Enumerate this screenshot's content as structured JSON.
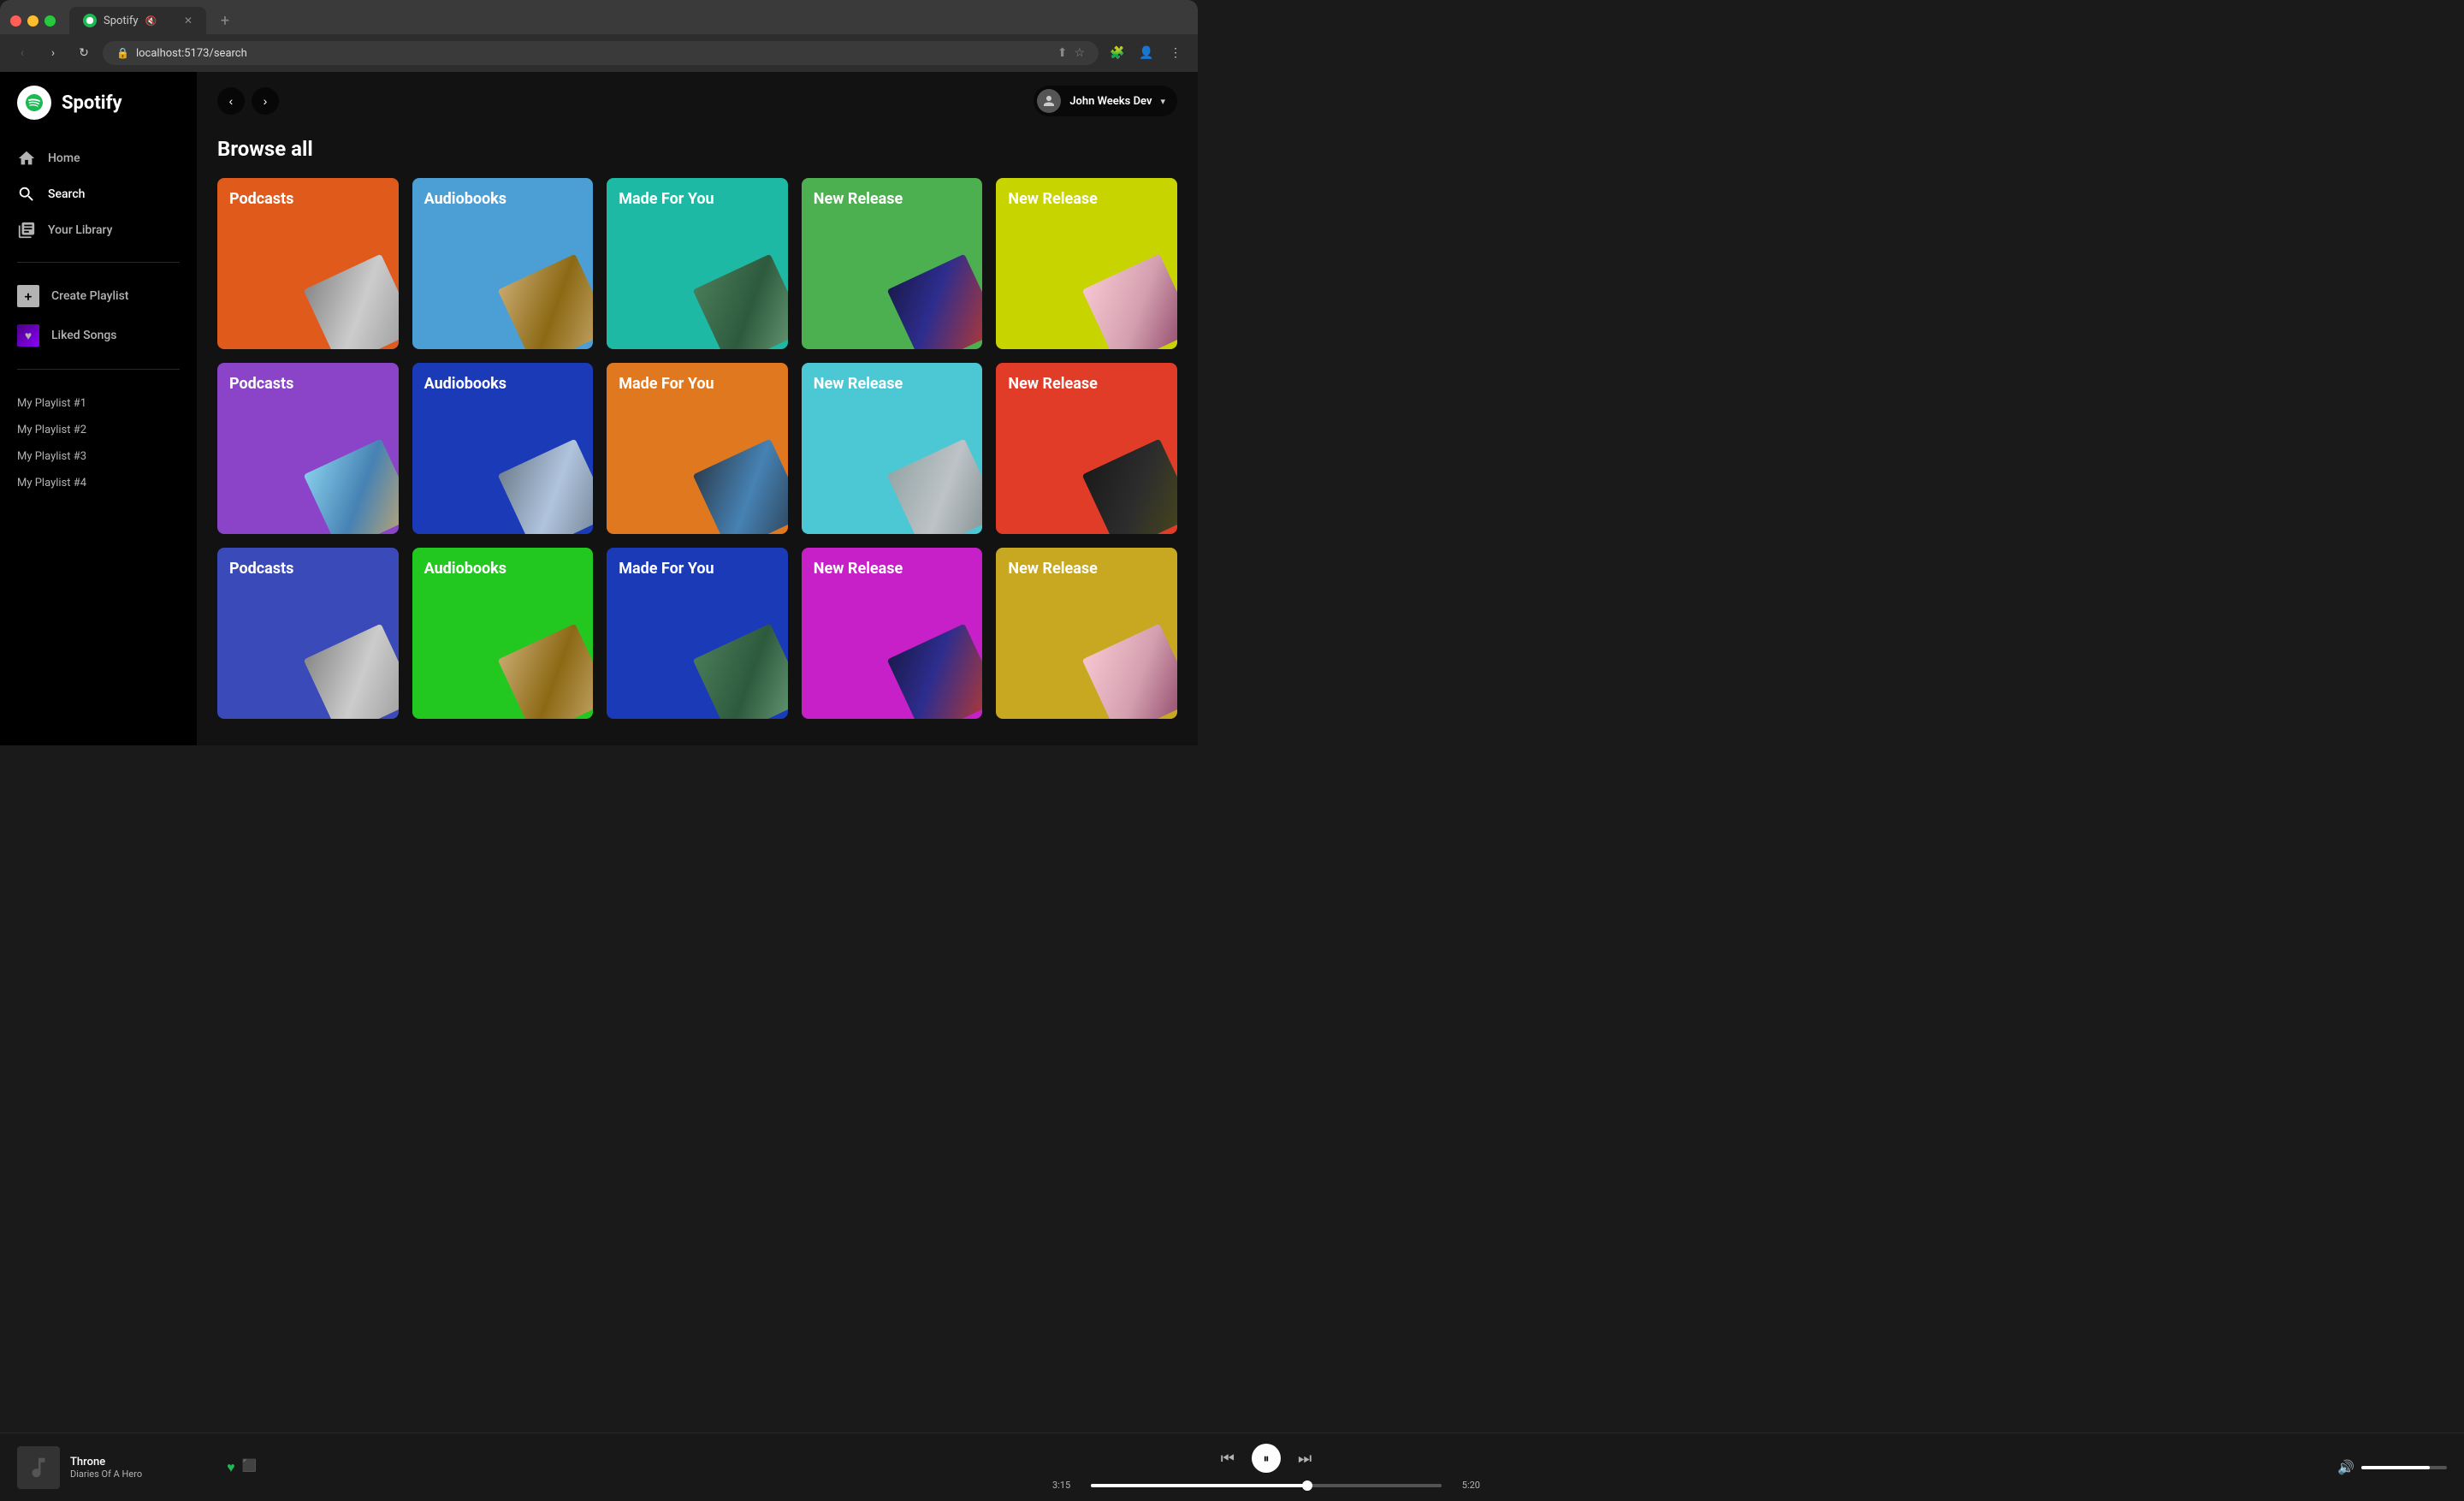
{
  "browser": {
    "tab_title": "Spotify",
    "tab_favicon": "🎵",
    "mute_icon": "🔇",
    "close_icon": "✕",
    "new_tab_icon": "+",
    "address": "localhost:5173/search",
    "back_disabled": false,
    "forward_enabled": true
  },
  "header": {
    "user_name": "John Weeks Dev",
    "user_chevron": "▾",
    "nav_back": "‹",
    "nav_forward": "›"
  },
  "sidebar": {
    "logo_text": "Spotify",
    "nav_items": [
      {
        "id": "home",
        "label": "Home",
        "icon": "home"
      },
      {
        "id": "search",
        "label": "Search",
        "icon": "search"
      },
      {
        "id": "library",
        "label": "Your Library",
        "icon": "library"
      }
    ],
    "actions": [
      {
        "id": "create-playlist",
        "label": "Create Playlist",
        "icon": "plus"
      },
      {
        "id": "liked-songs",
        "label": "Liked Songs",
        "icon": "heart"
      }
    ],
    "playlists": [
      "My Playlist #1",
      "My Playlist #2",
      "My Playlist #3",
      "My Playlist #4"
    ]
  },
  "main": {
    "browse_title": "Browse all",
    "categories": [
      {
        "id": "cat-1",
        "label": "Podcasts",
        "color": "#e05a1c",
        "photo_class": "photo-cat"
      },
      {
        "id": "cat-2",
        "label": "Audiobooks",
        "color": "#4b9fd5",
        "photo_class": "photo-road"
      },
      {
        "id": "cat-3",
        "label": "Made For You",
        "color": "#1db9a4",
        "photo_class": "photo-barn"
      },
      {
        "id": "cat-4",
        "label": "New Release",
        "color": "#4caf50",
        "photo_class": "photo-bokeh"
      },
      {
        "id": "cat-5",
        "label": "New Release",
        "color": "#c8d400",
        "photo_class": "photo-cherry"
      },
      {
        "id": "cat-6",
        "label": "Podcasts",
        "color": "#8b44c8",
        "photo_class": "photo-sky"
      },
      {
        "id": "cat-7",
        "label": "Audiobooks",
        "color": "#1a3ab8",
        "photo_class": "photo-skate"
      },
      {
        "id": "cat-8",
        "label": "Made For You",
        "color": "#e07820",
        "photo_class": "photo-road2"
      },
      {
        "id": "cat-9",
        "label": "New Release",
        "color": "#4bc8d4",
        "photo_class": "photo-house"
      },
      {
        "id": "cat-10",
        "label": "New Release",
        "color": "#e03c28",
        "photo_class": "photo-black"
      },
      {
        "id": "cat-11",
        "label": "Podcasts",
        "color": "#3a4ab8",
        "photo_class": "photo-cat"
      },
      {
        "id": "cat-12",
        "label": "Audiobooks",
        "color": "#22c820",
        "photo_class": "photo-road"
      },
      {
        "id": "cat-13",
        "label": "Made For You",
        "color": "#1a3ab8",
        "photo_class": "photo-barn"
      },
      {
        "id": "cat-14",
        "label": "New Release",
        "color": "#c820c8",
        "photo_class": "photo-bokeh"
      },
      {
        "id": "cat-15",
        "label": "New Release",
        "color": "#c8a820",
        "photo_class": "photo-cherry"
      }
    ]
  },
  "player": {
    "track_name": "Throne",
    "track_artist": "Diaries Of A Hero",
    "current_time": "3:15",
    "total_time": "5:20",
    "progress_percent": 62,
    "volume_percent": 80,
    "heart_filled": true,
    "prev_icon": "⏮",
    "play_icon": "⏸",
    "next_icon": "⏭",
    "volume_icon": "🔊"
  }
}
